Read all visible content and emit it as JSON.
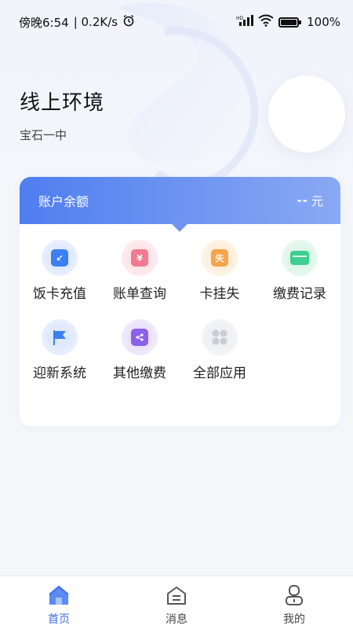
{
  "status_bar": {
    "time": "傍晚6:54",
    "speed": "| 0.2K/s",
    "battery": "100%"
  },
  "header": {
    "title": "线上环境",
    "subtitle": "宝石一中"
  },
  "balance": {
    "label": "账户余额",
    "value": "--",
    "unit": "元"
  },
  "apps": [
    {
      "label": "饭卡充值",
      "icon": "card-recharge-icon",
      "color": "#3b7ff0",
      "glow": "#dfe9fd"
    },
    {
      "label": "账单查询",
      "icon": "bill-query-icon",
      "color": "#f07a8e",
      "glow": "#fde4e8"
    },
    {
      "label": "卡挂失",
      "icon": "card-loss-icon",
      "color": "#f5a54a",
      "glow": "#fdefdc"
    },
    {
      "label": "缴费记录",
      "icon": "payment-record-icon",
      "color": "#3fcf8f",
      "glow": "#def6ea"
    },
    {
      "label": "迎新系统",
      "icon": "welcome-flag-icon",
      "color": "#3b7ff0",
      "glow": "#dfe9fd"
    },
    {
      "label": "其他缴费",
      "icon": "other-payment-icon",
      "color": "#8b62e8",
      "glow": "#ebe2fb"
    },
    {
      "label": "全部应用",
      "icon": "all-apps-icon",
      "color": "#c9cdd4",
      "glow": "#eef0f3"
    }
  ],
  "tabs": [
    {
      "label": "首页",
      "icon": "home-icon",
      "active": true
    },
    {
      "label": "消息",
      "icon": "message-icon",
      "active": false
    },
    {
      "label": "我的",
      "icon": "profile-icon",
      "active": false
    }
  ],
  "colors": {
    "accent": "#3d6ee8",
    "balance_gradient_start": "#4f7ef0",
    "balance_gradient_end": "#8aa9f3",
    "background": "#f4f6fa"
  }
}
